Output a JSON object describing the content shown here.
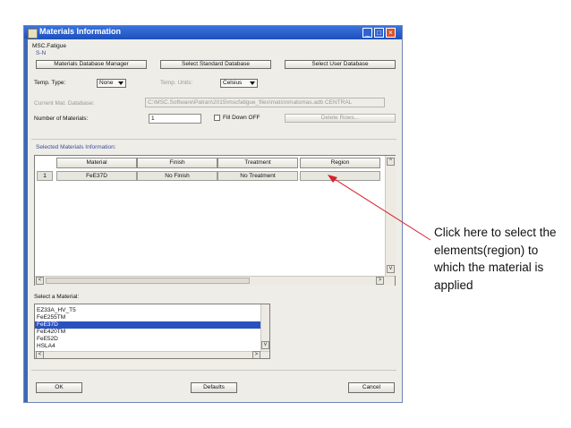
{
  "window": {
    "title": "Materials Information"
  },
  "header": {
    "app_label": "MSC.Fatigue",
    "mode_label": "S-N"
  },
  "top_buttons": {
    "db_manager": "Materials Database Manager",
    "std_db": "Select Standard Database",
    "user_db": "Select User Database"
  },
  "temp": {
    "type_label": "Temp. Type:",
    "type_value": "None",
    "units_label": "Temp. Units:",
    "units_value": "Celsius"
  },
  "database": {
    "label": "Current Mat. Database:",
    "path": "C:\\MSC.Software\\Patran\\2015\\mscfatigue_files\\mats\\nmatsmas.adb CENTRAL"
  },
  "num_materials": {
    "label": "Number of Materials:",
    "value": "1"
  },
  "fill_down": {
    "label": "Fill Down OFF"
  },
  "delete_rows": {
    "label": "Delete Rows..."
  },
  "selected_section": {
    "label": "Selected Materials Information:"
  },
  "table": {
    "columns": [
      "Material",
      "Finish",
      "Treatment",
      "Region"
    ],
    "rows": [
      {
        "num": "1",
        "material": "FeE37D",
        "finish": "No Finish",
        "treatment": "No Treatment",
        "region": ""
      }
    ]
  },
  "material_select": {
    "label": "Select a Material:",
    "items": [
      "EZ33A_HV_T5",
      "FeE255TM",
      "FeE37D",
      "FeE420TM",
      "FeE52D",
      "HSLA4"
    ],
    "selected": "FeE37D"
  },
  "footer": {
    "ok": "OK",
    "defaults": "Defaults",
    "cancel": "Cancel"
  },
  "annotation": {
    "text": "Click here to select the elements(region) to  which the material is applied",
    "arrow_color": "#d9202a"
  },
  "colors": {
    "titlebar": "#2a5fd1",
    "selection": "#2a52be",
    "close": "#d9542d"
  }
}
